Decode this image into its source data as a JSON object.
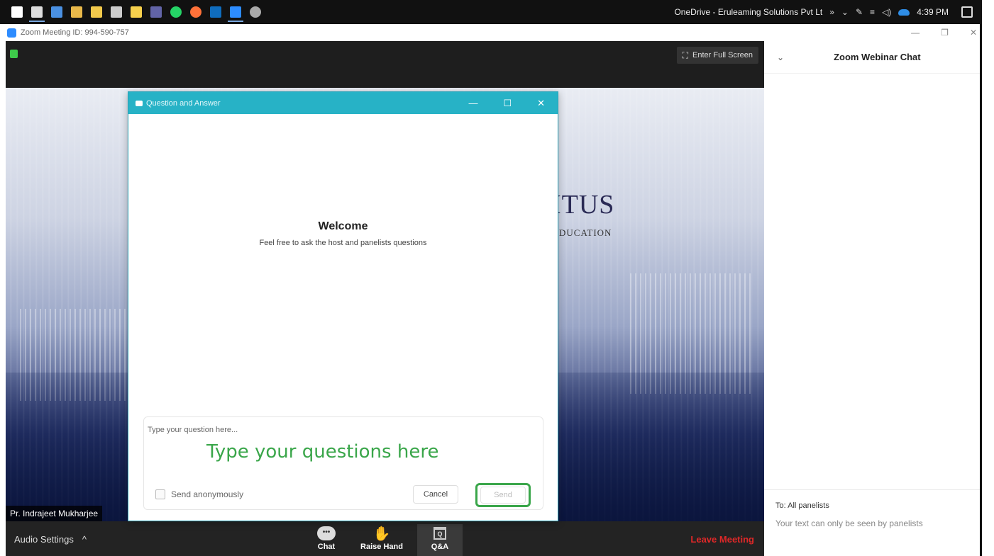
{
  "taskbar": {
    "icons": [
      {
        "name": "windows-start-icon",
        "color": "#ffffff"
      },
      {
        "name": "task-view-icon",
        "color": "#dddddd"
      },
      {
        "name": "mail-icon",
        "color": "#4a90e2"
      },
      {
        "name": "file-explorer-icon",
        "color": "#e8b84a"
      },
      {
        "name": "notes-icon",
        "color": "#f2c94c"
      },
      {
        "name": "calculator-icon",
        "color": "#cccccc"
      },
      {
        "name": "sticky-notes-icon",
        "color": "#f6d04d"
      },
      {
        "name": "teams-icon",
        "color": "#6264a7"
      },
      {
        "name": "whatsapp-icon",
        "color": "#25d366"
      },
      {
        "name": "firefox-icon",
        "color": "#ff7139"
      },
      {
        "name": "outlook-icon",
        "color": "#0f6cbd"
      },
      {
        "name": "zoom-taskbar-icon",
        "color": "#2d8cff"
      },
      {
        "name": "paint-icon",
        "color": "#aaaaaa"
      }
    ],
    "tray_text": "OneDrive - Eruleaming Solutions Pvt Lt",
    "tray_chevrons": "»",
    "clock": "4:39 PM"
  },
  "window": {
    "title": "Zoom Meeting ID: 994-590-757",
    "minimize": "—",
    "restore": "❐",
    "close": "✕"
  },
  "video": {
    "full_screen_label": "Enter Full Screen",
    "brand_line1": "ITUS",
    "brand_line2": "DUCATION",
    "speaker_name": "Pr. Indrajeet Mukharjee"
  },
  "toolbar": {
    "audio_label": "Audio Settings",
    "audio_caret": "^",
    "chat_label": "Chat",
    "chat_glyph": "•••",
    "raise_hand_label": "Raise Hand",
    "qa_label": "Q&A",
    "qa_glyph": "Q",
    "leave_label": "Leave Meeting"
  },
  "chat": {
    "title": "Zoom Webinar Chat",
    "collapse": "⌄",
    "to_label": "To: All panelists",
    "note": "Your text can only be seen by panelists"
  },
  "qa": {
    "title": "Question and Answer",
    "minimize": "—",
    "maximize": "☐",
    "close": "✕",
    "welcome": "Welcome",
    "welcome_sub": "Feel free to ask the host and panelists questions",
    "input_placeholder": "Type your question here...",
    "annotation": "Type your questions here",
    "anonymous_label": "Send anonymously",
    "cancel_label": "Cancel",
    "send_label": "Send",
    "highlight_color": "#3aa64a"
  }
}
